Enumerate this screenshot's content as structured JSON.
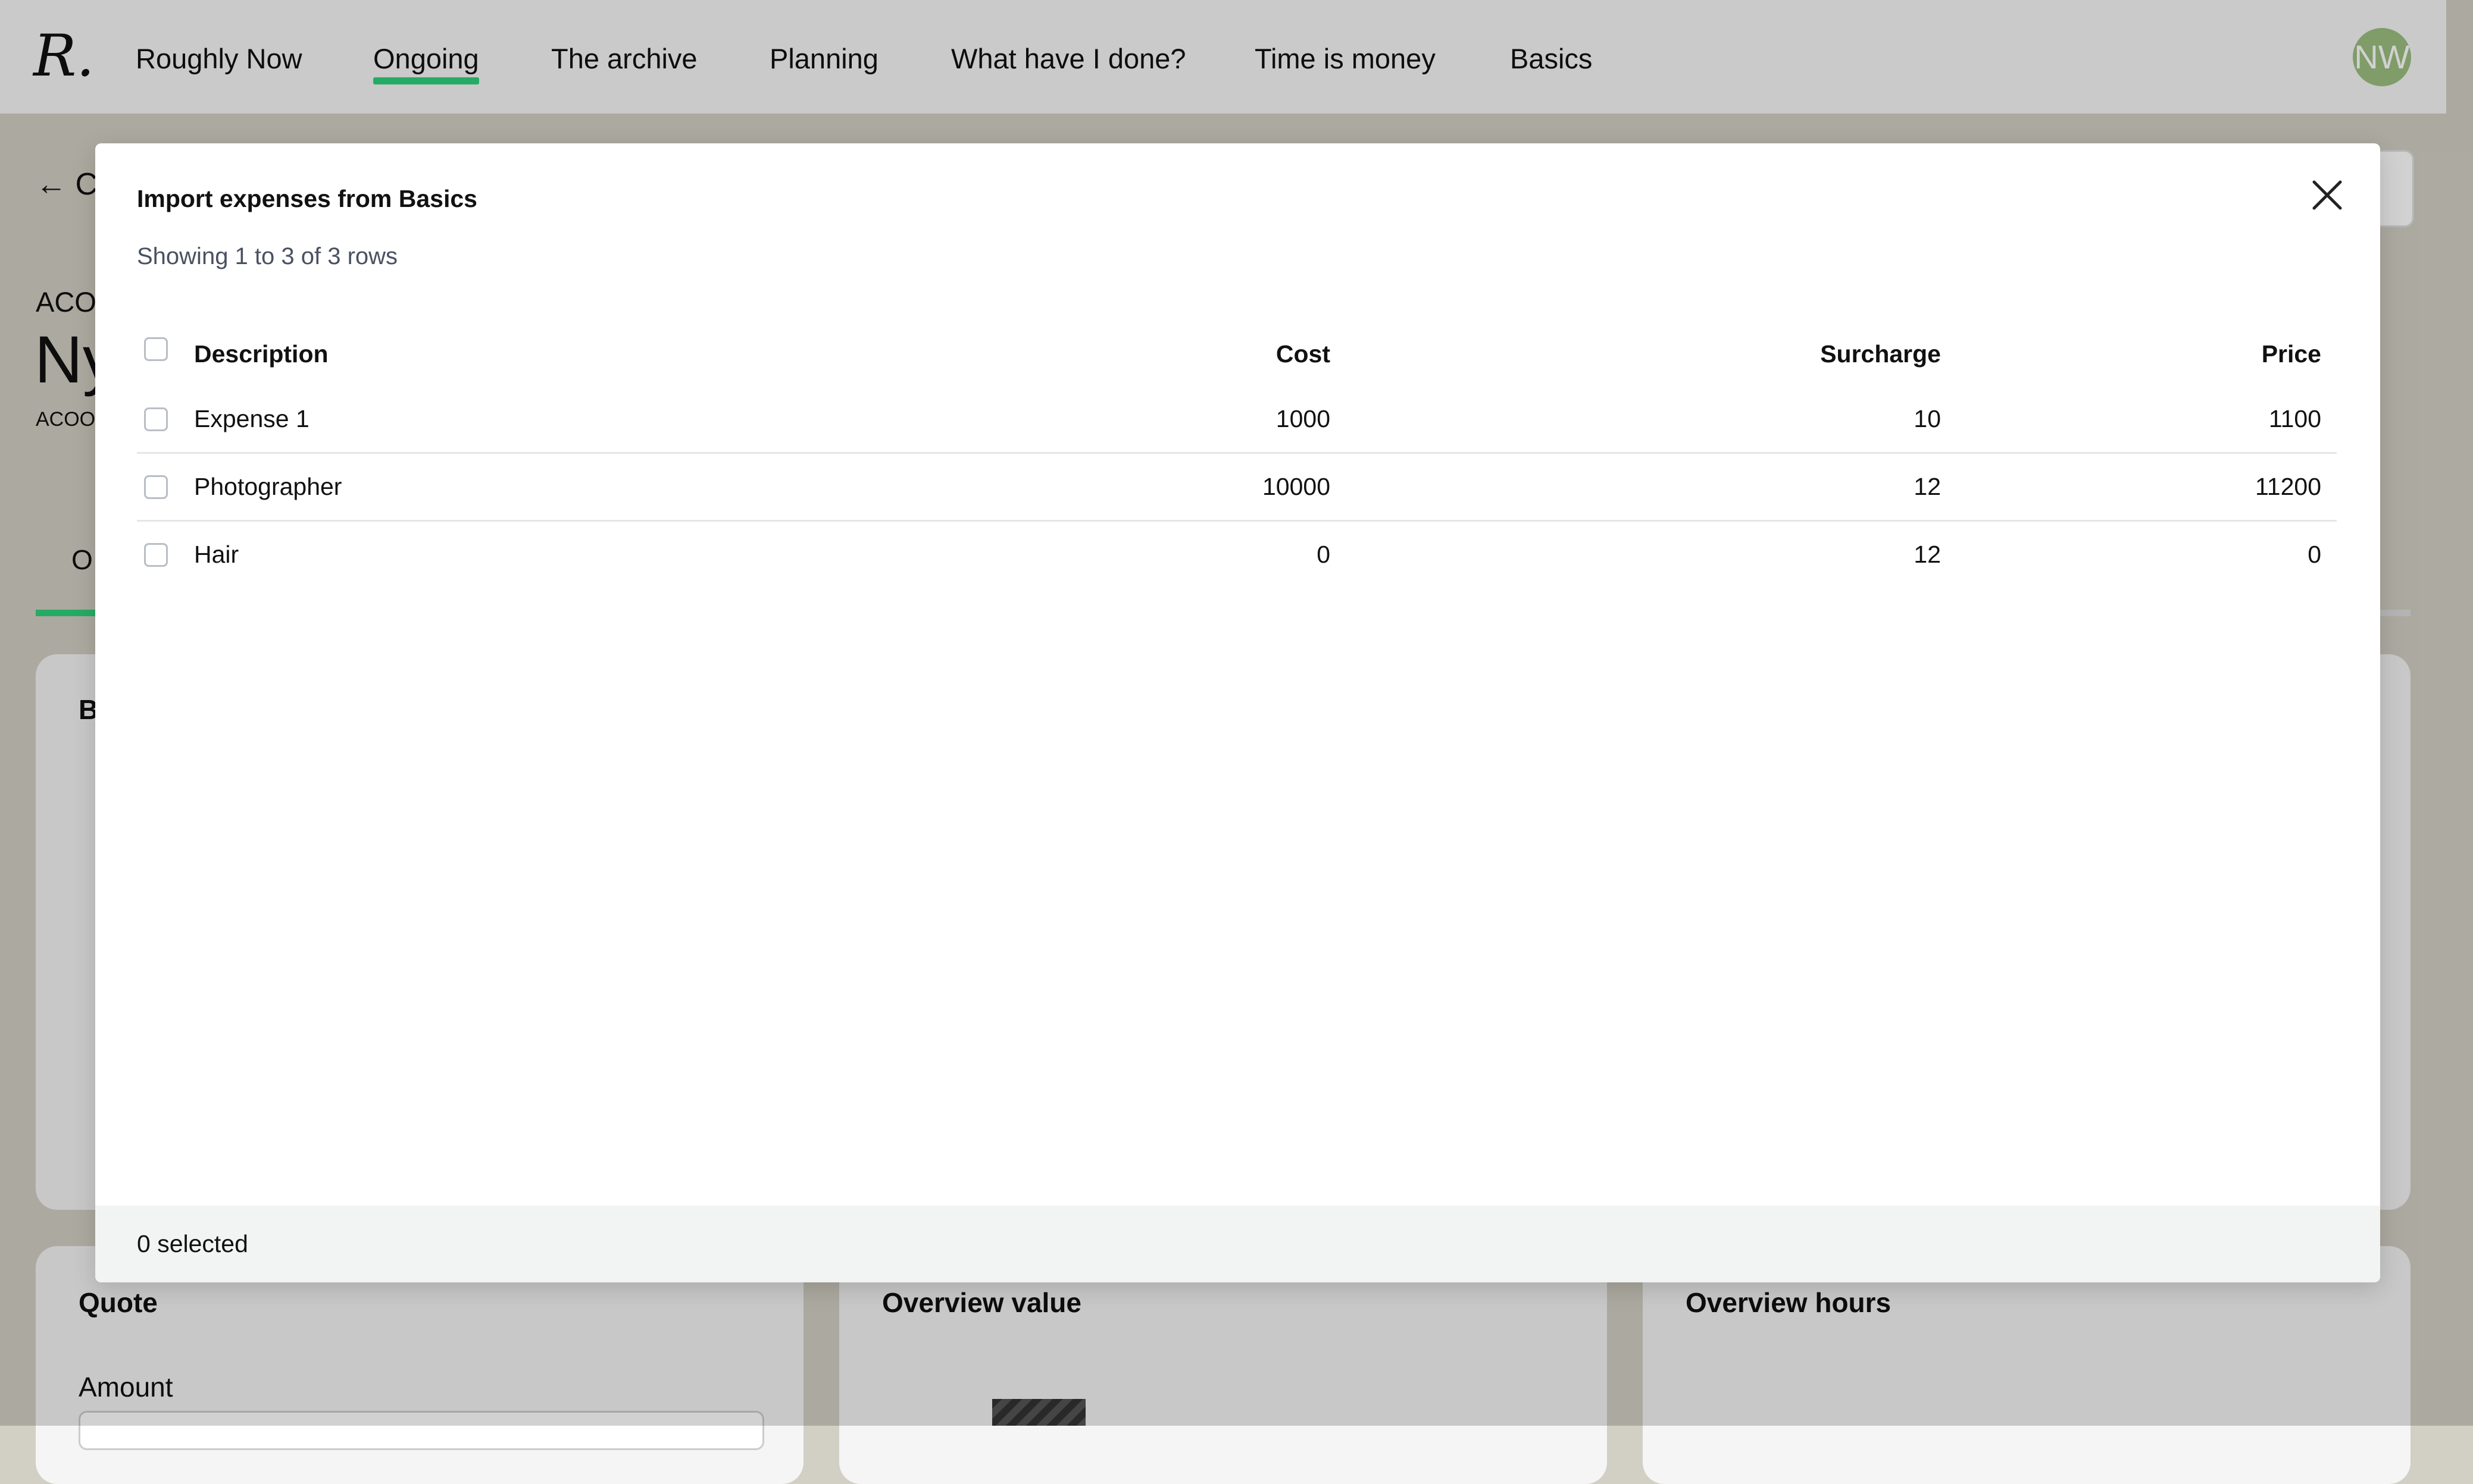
{
  "app": {
    "logo_text": "R.",
    "nav": [
      "Roughly Now",
      "Ongoing",
      "The archive",
      "Planning",
      "What have I done?",
      "Time is money",
      "Basics"
    ],
    "active_nav": "Ongoing",
    "avatar_initials": "NW"
  },
  "background": {
    "back_link": "← C",
    "project_code": "ACO",
    "project_title": "Ny",
    "project_subcode": "ACOO",
    "tab_partial": "O",
    "card_partial_heading": "B",
    "cards": [
      "Quote",
      "Overview value",
      "Overview hours"
    ],
    "amount_label": "Amount"
  },
  "modal": {
    "title": "Import expenses from Basics",
    "subtitle": "Showing 1 to 3 of 3 rows",
    "close_icon": "close-x-icon",
    "columns": [
      "Description",
      "Cost",
      "Surcharge",
      "Price"
    ],
    "rows": [
      {
        "description": "Expense 1",
        "cost": "1000",
        "surcharge": "10",
        "price": "1100"
      },
      {
        "description": "Photographer",
        "cost": "10000",
        "surcharge": "12",
        "price": "11200"
      },
      {
        "description": "Hair",
        "cost": "0",
        "surcharge": "12",
        "price": "0"
      }
    ],
    "footer": "0 selected"
  },
  "colors": {
    "accent": "#2fd17a",
    "avatar": "#9bbf80",
    "footer_bg": "#f1f4f3"
  }
}
